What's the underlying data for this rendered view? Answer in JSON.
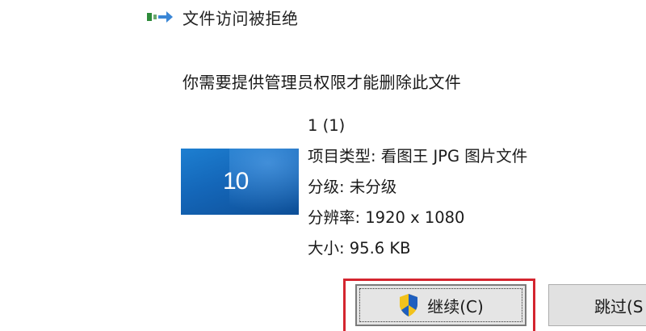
{
  "dialog": {
    "title": "文件访问被拒绝",
    "message": "你需要提供管理员权限才能删除此文件"
  },
  "file": {
    "thumbnail_text": "10",
    "name": "1 (1)",
    "type_line": "项目类型: 看图王 JPG 图片文件",
    "rating_line": "分级: 未分级",
    "resolution_line": "分辨率: 1920 x 1080",
    "size_line": "大小: 95.6 KB"
  },
  "buttons": {
    "continue_label": "继续(C)",
    "skip_label": "跳过(S"
  },
  "colors": {
    "highlight": "#d4252f",
    "thumbnail": "#1466b8"
  },
  "icons": [
    "file-move-icon",
    "uac-shield-icon"
  ]
}
